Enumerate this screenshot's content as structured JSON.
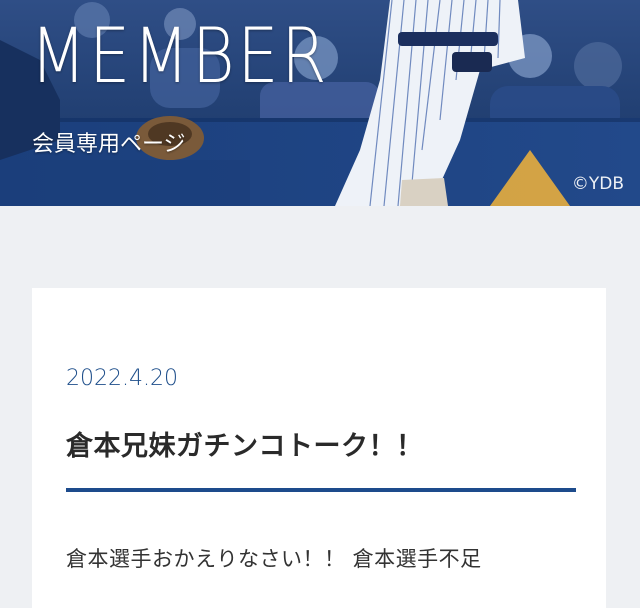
{
  "hero": {
    "title": "MEMBER",
    "subtitle": "会員専用ページ",
    "credit": "©YDB"
  },
  "post": {
    "date": "2022.4.20",
    "title": "倉本兄妹ガチンコトーク！！",
    "excerpt": "倉本選手おかえりなさい！！ 倉本選手不足"
  },
  "colors": {
    "page_background": "#eef0f3",
    "card_background": "#ffffff",
    "accent_blue": "#1d4b8c",
    "date_blue": "#1f4f8b",
    "title_text": "#2a2a2a"
  }
}
